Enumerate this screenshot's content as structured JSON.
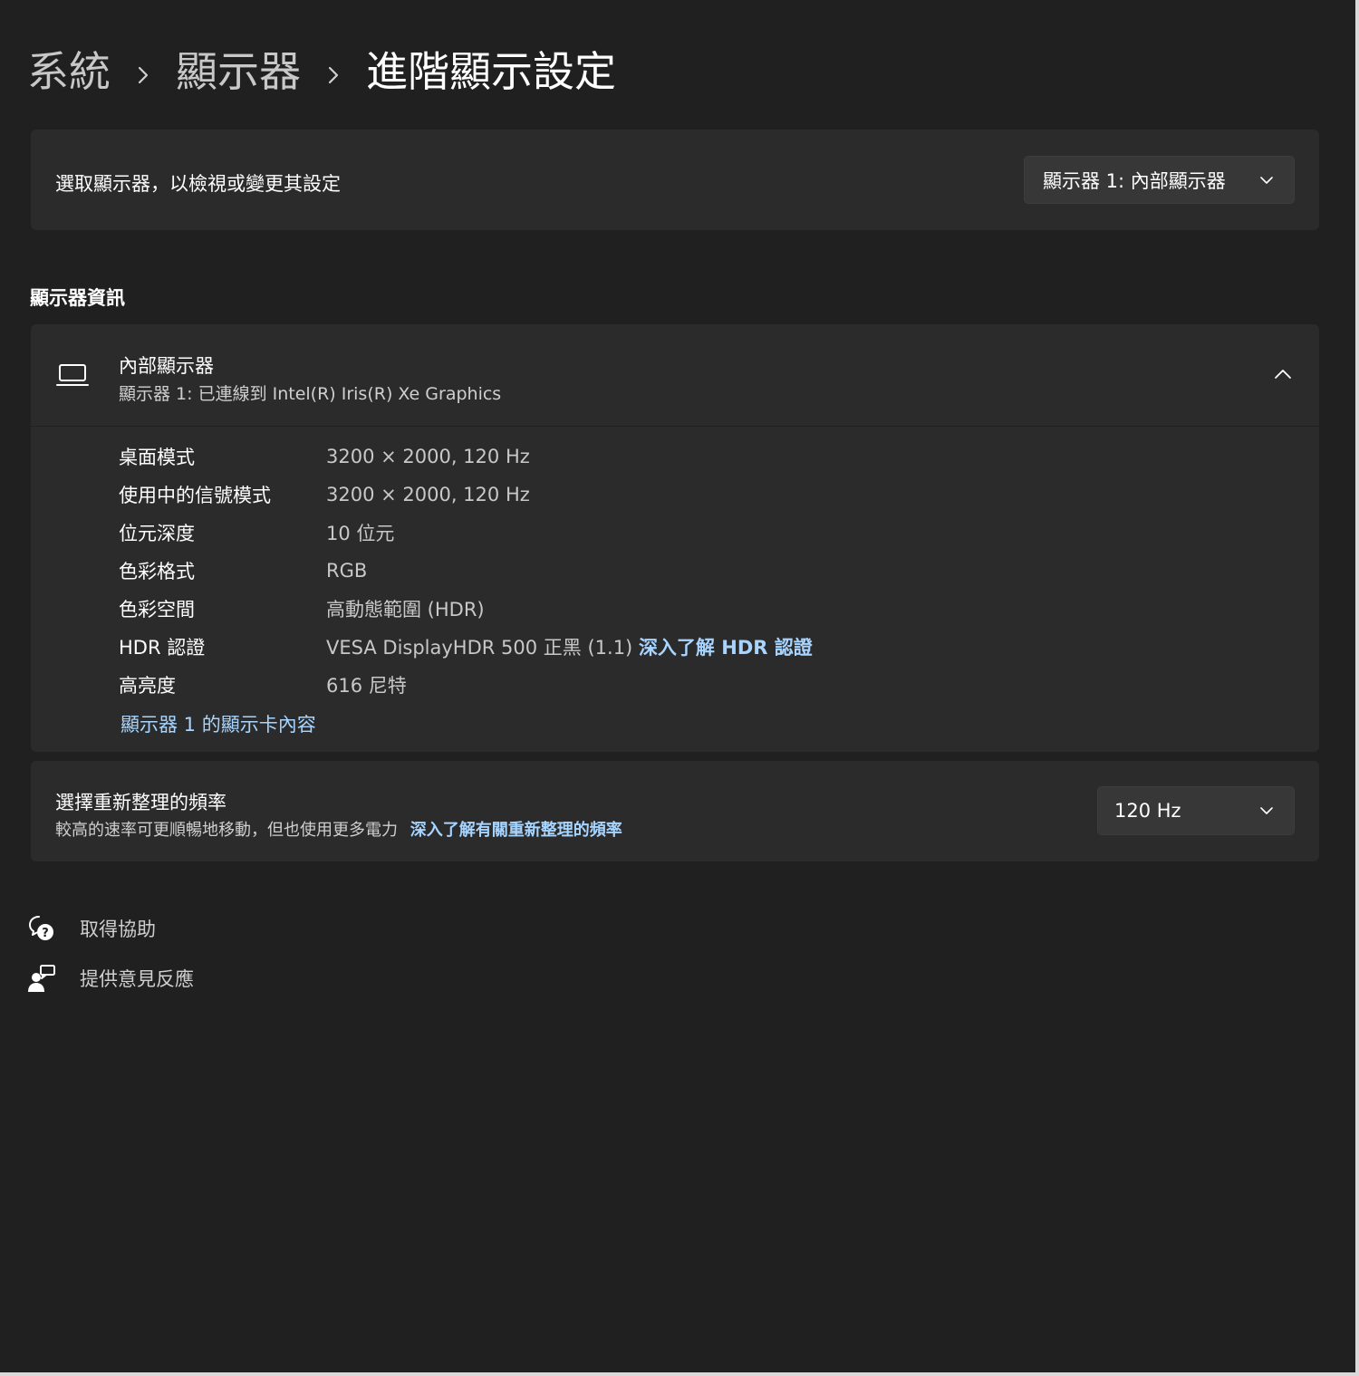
{
  "breadcrumb": {
    "items": [
      "系統",
      "顯示器"
    ],
    "current": "進階顯示設定"
  },
  "select_display": {
    "label": "選取顯示器，以檢視或變更其設定",
    "dropdown_value": "顯示器 1: 內部顯示器"
  },
  "display_info": {
    "section_title": "顯示器資訊",
    "title": "內部顯示器",
    "subtitle": "顯示器 1: 已連線到 Intel(R) Iris(R) Xe Graphics",
    "rows": [
      {
        "key": "桌面模式",
        "value": "3200 × 2000, 120 Hz"
      },
      {
        "key": "使用中的信號模式",
        "value": "3200 × 2000, 120 Hz"
      },
      {
        "key": "位元深度",
        "value": "10 位元"
      },
      {
        "key": "色彩格式",
        "value": "RGB"
      },
      {
        "key": "色彩空間",
        "value": "高動態範圍 (HDR)"
      },
      {
        "key": "HDR 認證",
        "value": "VESA DisplayHDR 500 正黑 (1.1)",
        "link": "深入了解 HDR 認證"
      },
      {
        "key": "高亮度",
        "value": "616 尼特"
      }
    ],
    "adapter_link": "顯示器 1 的顯示卡內容"
  },
  "refresh_rate": {
    "title": "選擇重新整理的頻率",
    "description": "較高的速率可更順暢地移動，但也使用更多電力",
    "learn_link": "深入了解有關重新整理的頻率",
    "dropdown_value": "120 Hz"
  },
  "footer": {
    "get_help": "取得協助",
    "feedback": "提供意見反應"
  },
  "colors": {
    "background": "#202020",
    "card": "#2b2b2b",
    "accent_link": "#a7d5ff"
  }
}
